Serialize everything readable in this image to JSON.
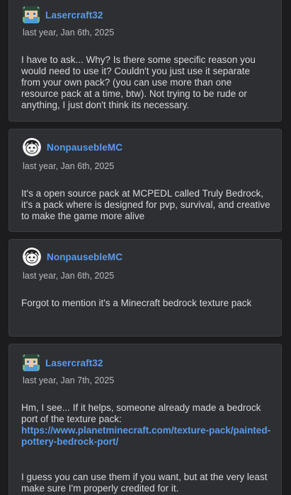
{
  "posts": [
    {
      "username": "Lasercraft32",
      "avatar": "pixel-art-avatar",
      "date": "last year, Jan 6th, 2025",
      "body": "I have to ask... Why? Is there some specific reason you would need to use it? Couldn't you just use it separate from your own pack? (you can use more than one resource pack at a time, btw). Not trying to be rude or anything, I just don't think its necessary."
    },
    {
      "username": "NonpausebleMC",
      "avatar": "cartoon-face-avatar",
      "date": "last year, Jan 6th, 2025",
      "body": "It's a open source pack at MCPEDL called Truly Bedrock, it's a pack where is designed for pvp, survival, and creative to make the game more alive"
    },
    {
      "username": "NonpausebleMC",
      "avatar": "cartoon-face-avatar",
      "date": "last year, Jan 6th, 2025",
      "body": "Forgot to mention it's a Minecraft bedrock texture pack"
    },
    {
      "username": "Lasercraft32",
      "avatar": "pixel-art-avatar",
      "date": "last year, Jan 7th, 2025",
      "body": "Hm, I see... If it helps, someone already made a bedrock port of the texture pack:",
      "link": "https://www.planetminecraft.com/texture-pack/painted-pottery-bedrock-port/",
      "body2": "I guess you can use them if you want, but at the very least make sure I'm properly credited for it."
    }
  ],
  "colors": {
    "background": "#1c1c1e",
    "card": "#2e2f33",
    "username": "#5a9bea",
    "body_text": "#d8d9dc",
    "date_text": "#b9babe"
  }
}
